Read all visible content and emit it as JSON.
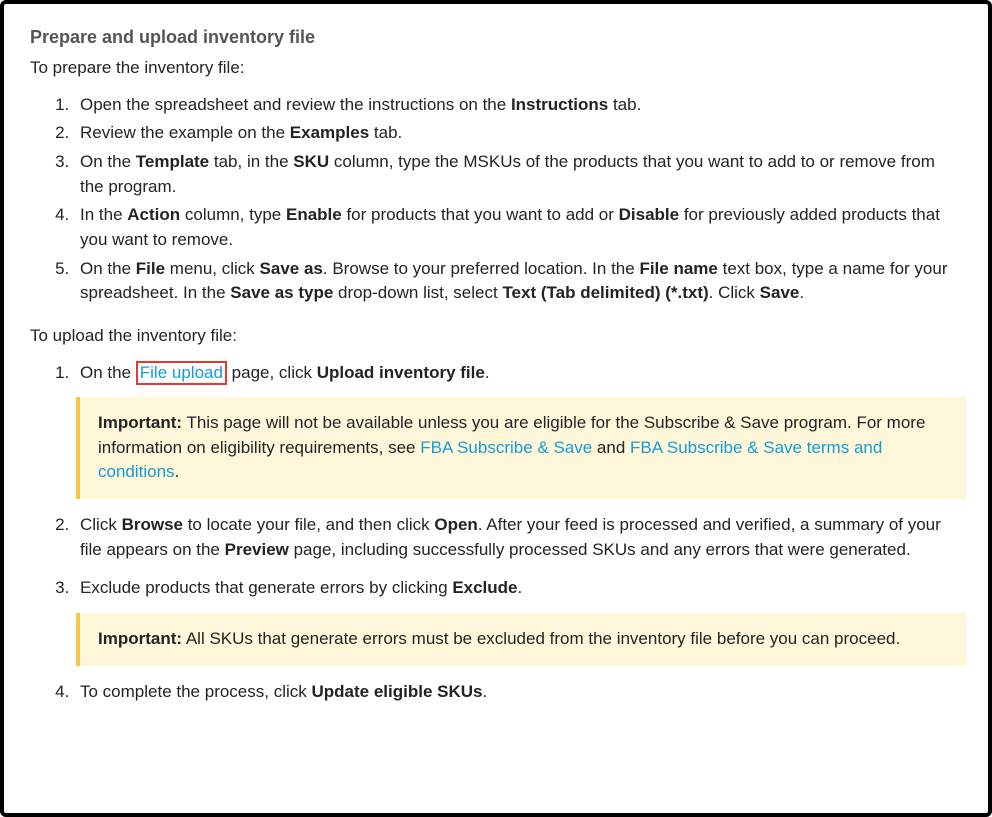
{
  "title": "Prepare and upload inventory file",
  "prepare_intro": "To prepare the inventory file:",
  "prepare": {
    "s1a": "Open the spreadsheet and review the instructions on the ",
    "s1b": "Instructions",
    "s1c": " tab.",
    "s2a": "Review the example on the ",
    "s2b": "Examples",
    "s2c": " tab.",
    "s3a": "On the ",
    "s3b": "Template",
    "s3c": " tab, in the ",
    "s3d": "SKU",
    "s3e": " column, type the MSKUs of the products that you want to add to or remove from the program.",
    "s4a": "In the ",
    "s4b": "Action",
    "s4c": " column, type ",
    "s4d": "Enable",
    "s4e": " for products that you want to add or ",
    "s4f": "Disable",
    "s4g": " for previously added products that you want to remove.",
    "s5a": "On the ",
    "s5b": "File",
    "s5c": " menu, click ",
    "s5d": "Save as",
    "s5e": ". Browse to your preferred location. In the ",
    "s5f": "File name",
    "s5g": " text box, type a name for your spreadsheet. In the ",
    "s5h": "Save as type",
    "s5i": " drop-down list, select ",
    "s5j": "Text (Tab delimited) (*.txt)",
    "s5k": ". Click ",
    "s5l": "Save",
    "s5m": "."
  },
  "upload_intro": "To upload the inventory file:",
  "upload": {
    "s1a": "On the ",
    "s1b": "File upload",
    "s1c": " page, click ",
    "s1d": "Upload inventory file",
    "s1e": ".",
    "s2a": "Click ",
    "s2b": "Browse",
    "s2c": " to locate your file, and then click ",
    "s2d": "Open",
    "s2e": ". After your feed is processed and verified, a summary of your file appears on the ",
    "s2f": "Preview",
    "s2g": " page, including successfully processed SKUs and any errors that were generated.",
    "s3a": "Exclude products that generate errors by clicking ",
    "s3b": "Exclude",
    "s3c": ".",
    "s4a": "To complete the process, click ",
    "s4b": "Update eligible SKUs",
    "s4c": "."
  },
  "callout1": {
    "label": "Important:",
    "t1": " This page will not be available unless you are eligible for the Subscribe & Save program. For more information on eligibility requirements, see ",
    "link1": "FBA Subscribe & Save",
    "t2": " and ",
    "link2": "FBA Subscribe & Save terms and conditions",
    "t3": "."
  },
  "callout2": {
    "label": "Important:",
    "text": " All SKUs that generate errors must be excluded from the inventory file before you can proceed."
  }
}
